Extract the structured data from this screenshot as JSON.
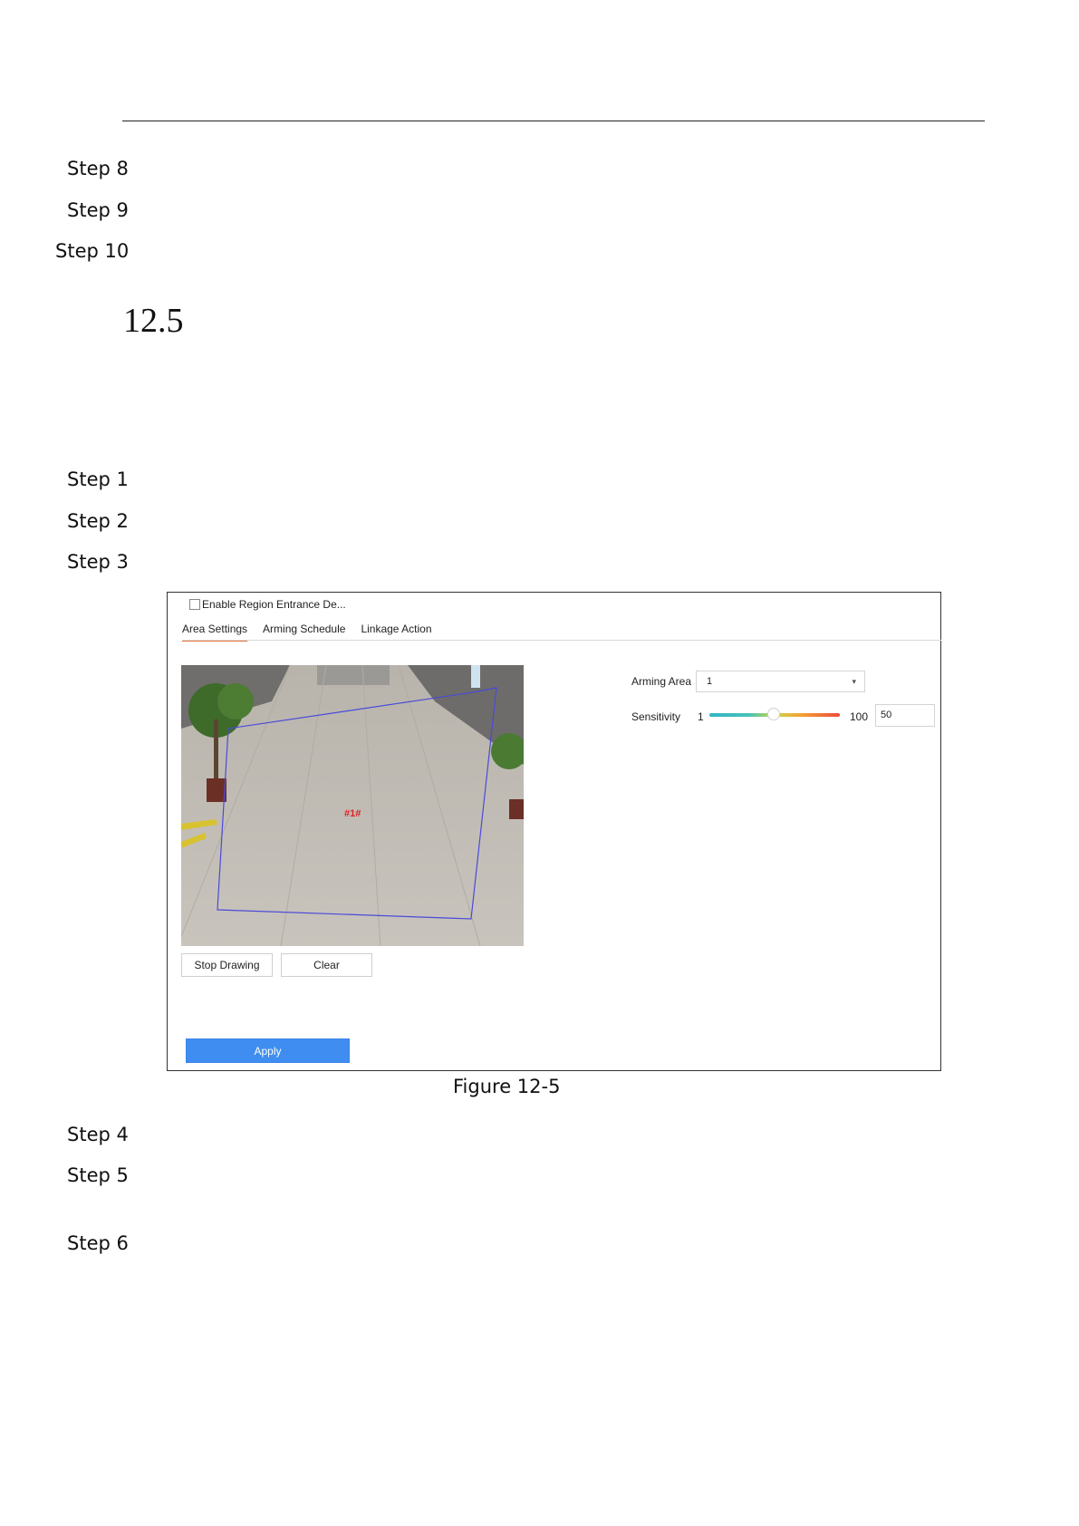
{
  "steps_top": [
    "Step 8",
    "Step 9",
    "Step 10"
  ],
  "section_number": "12.5",
  "steps_mid": [
    "Step 1",
    "Step 2",
    "Step 3"
  ],
  "figure": {
    "enable_label": "Enable Region Entrance De...",
    "tabs": [
      "Area Settings",
      "Arming Schedule",
      "Linkage Action"
    ],
    "region_tag": "#1#",
    "stop_drawing_label": "Stop Drawing",
    "clear_label": "Clear",
    "apply_label": "Apply",
    "arming_area_label": "Arming Area",
    "arming_area_value": "1",
    "sensitivity_label": "Sensitivity",
    "sensitivity_min": "1",
    "sensitivity_max": "100",
    "sensitivity_value": "50",
    "sensitivity_level": 50,
    "accent_color": "#3f8df0",
    "tab_underline_color": "#e8743b",
    "region_outline_color": "#4a4ad8",
    "region_tag_color": "#e02020"
  },
  "caption": "Figure 12-5",
  "steps_bottom": [
    "Step 4",
    "Step 5",
    "Step 6"
  ]
}
